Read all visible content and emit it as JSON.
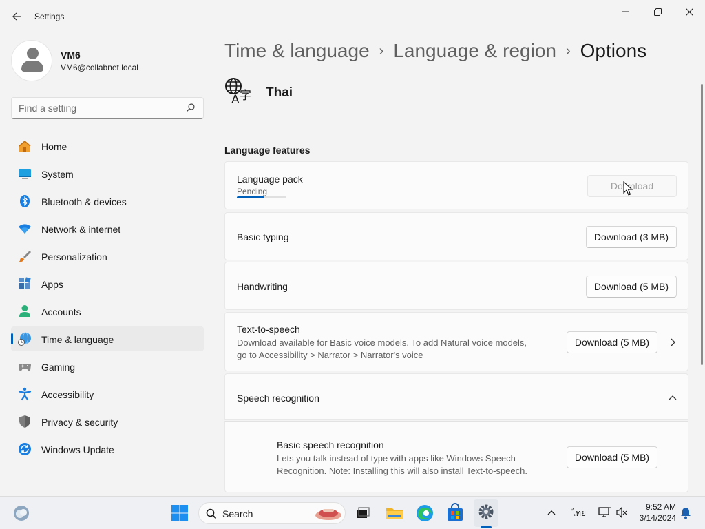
{
  "window": {
    "title": "Settings",
    "minimize": "—",
    "maximize": "❐",
    "close": "✕"
  },
  "user": {
    "name": "VM6",
    "email": "VM6@collabnet.local"
  },
  "search": {
    "placeholder": "Find a setting"
  },
  "sidebar": {
    "items": [
      {
        "label": "Home",
        "icon": "home-icon"
      },
      {
        "label": "System",
        "icon": "system-icon"
      },
      {
        "label": "Bluetooth & devices",
        "icon": "bluetooth-icon"
      },
      {
        "label": "Network & internet",
        "icon": "wifi-icon"
      },
      {
        "label": "Personalization",
        "icon": "brush-icon"
      },
      {
        "label": "Apps",
        "icon": "apps-icon"
      },
      {
        "label": "Accounts",
        "icon": "accounts-icon"
      },
      {
        "label": "Time & language",
        "icon": "globe-clock-icon",
        "active": true
      },
      {
        "label": "Gaming",
        "icon": "gamepad-icon"
      },
      {
        "label": "Accessibility",
        "icon": "accessibility-icon"
      },
      {
        "label": "Privacy & security",
        "icon": "shield-icon"
      },
      {
        "label": "Windows Update",
        "icon": "update-icon"
      }
    ]
  },
  "breadcrumb": {
    "items": [
      "Time & language",
      "Language & region"
    ],
    "separator": "›",
    "current": "Options"
  },
  "language": {
    "name": "Thai"
  },
  "features": {
    "title": "Language features",
    "language_pack": {
      "title": "Language pack",
      "status": "Pending",
      "progress": 0.55,
      "button": "Download",
      "button_disabled": true
    },
    "basic_typing": {
      "title": "Basic typing",
      "button": "Download (3 MB)"
    },
    "handwriting": {
      "title": "Handwriting",
      "button": "Download (5 MB)"
    },
    "tts": {
      "title": "Text-to-speech",
      "desc_line1": "Download available for Basic voice models. To add Natural voice models,",
      "desc_line2": "go to Accessibility > Narrator > Narrator's voice",
      "button": "Download (5 MB)"
    },
    "speech": {
      "title": "Speech recognition",
      "expanded": true,
      "basic": {
        "title": "Basic speech recognition",
        "desc_line1": "Lets you talk instead of type with apps like Windows Speech",
        "desc_line2": "Recognition. Note: Installing this will also install Text-to-speech.",
        "button": "Download (5 MB)"
      }
    }
  },
  "taskbar": {
    "search_label": "Search",
    "input_indicator": "ไทย",
    "time": "9:52 AM",
    "date": "3/14/2024"
  },
  "colors": {
    "accent": "#005fb8",
    "background": "#f3f3f3",
    "card": "#fbfbfb"
  }
}
